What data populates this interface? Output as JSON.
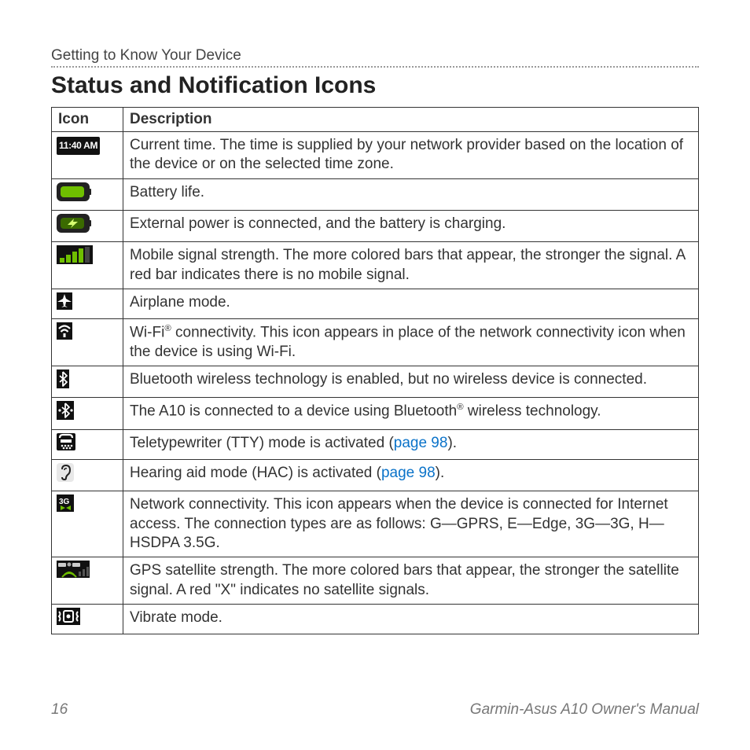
{
  "header": {
    "breadcrumb": "Getting to Know Your Device",
    "title": "Status and Notification Icons"
  },
  "table": {
    "headers": {
      "icon": "Icon",
      "description": "Description"
    },
    "rows": [
      {
        "icon_name": "time-icon",
        "icon_label": "11:40 AM",
        "desc": "Current time. The time is supplied by your network provider based on the location of the device or on the selected time zone."
      },
      {
        "icon_name": "battery-icon",
        "desc": "Battery life."
      },
      {
        "icon_name": "battery-charging-icon",
        "desc": "External power is connected, and the battery is charging."
      },
      {
        "icon_name": "signal-bars-icon",
        "desc": "Mobile signal strength. The more colored bars that appear, the stronger the signal. A red bar indicates there is no mobile signal."
      },
      {
        "icon_name": "airplane-mode-icon",
        "desc": "Airplane mode."
      },
      {
        "icon_name": "wifi-icon",
        "desc_html": "Wi-Fi<sup>®</sup> connectivity. This icon appears in place of the network connectivity icon when the device is using Wi-Fi."
      },
      {
        "icon_name": "bluetooth-icon",
        "desc": "Bluetooth wireless technology is enabled, but no wireless device is connected."
      },
      {
        "icon_name": "bluetooth-connected-icon",
        "desc_html": "The A10 is connected to a device using Bluetooth<sup>®</sup> wireless technology."
      },
      {
        "icon_name": "tty-icon",
        "desc_pre": "Teletypewriter (TTY) mode is activated (",
        "link": "page 98",
        "desc_post": ")."
      },
      {
        "icon_name": "hearing-aid-icon",
        "desc_pre": "Hearing aid mode (HAC) is activated (",
        "link": "page 98",
        "desc_post": ")."
      },
      {
        "icon_name": "network-3g-icon",
        "desc": "Network connectivity. This icon appears when the device is connected for Internet access. The connection types are as follows: G—GPRS, E—Edge, 3G—3G, H—HSDPA 3.5G."
      },
      {
        "icon_name": "gps-satellite-icon",
        "desc": "GPS satellite strength. The more colored bars that appear, the stronger the satellite signal. A red \"X\" indicates no satellite signals."
      },
      {
        "icon_name": "vibrate-icon",
        "desc": "Vibrate mode."
      }
    ]
  },
  "footer": {
    "page_number": "16",
    "manual_title": "Garmin-Asus A10 Owner's Manual"
  }
}
